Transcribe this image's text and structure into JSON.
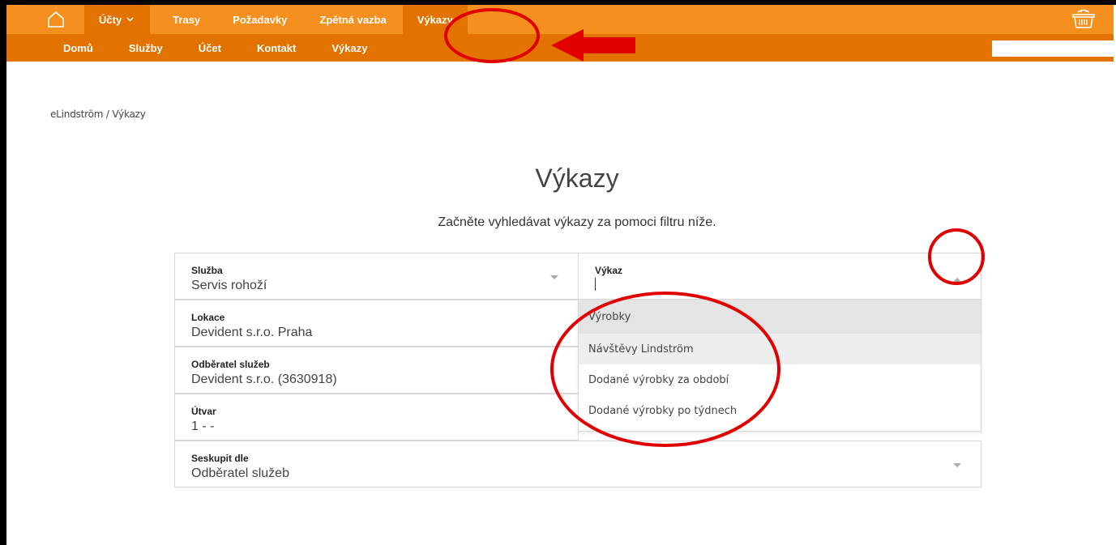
{
  "topnav": {
    "items": [
      {
        "label": "Účty",
        "has_dropdown": true
      },
      {
        "label": "Trasy"
      },
      {
        "label": "Požadavky"
      },
      {
        "label": "Zpětná vazba"
      },
      {
        "label": "Výkazy"
      }
    ]
  },
  "subnav": {
    "items": [
      "Domů",
      "Služby",
      "Účet",
      "Kontakt",
      "Výkazy"
    ],
    "search_placeholder": ""
  },
  "breadcrumb": "eLindström / Výkazy",
  "page": {
    "title": "Výkazy",
    "subtitle": "Začněte vyhledávat výkazy za pomoci filtru níže."
  },
  "form": {
    "sluzba": {
      "label": "Služba",
      "value": "Servis rohoží"
    },
    "lokace": {
      "label": "Lokace",
      "value": "Devident s.r.o. Praha"
    },
    "odberatel": {
      "label": "Odběratel služeb",
      "value": "Devident s.r.o. (3630918)"
    },
    "utvar": {
      "label": "Útvar",
      "value": "1 - -"
    },
    "seskupit": {
      "label": "Seskupit dle",
      "value": "Odběratel služeb"
    },
    "vykaz": {
      "label": "Výkaz",
      "value": ""
    }
  },
  "dropdown": {
    "options": [
      "Výrobky",
      "Návštěvy Lindström",
      "Dodané výrobky za období",
      "Dodané výrobky po týdnech"
    ]
  },
  "colors": {
    "nav_primary": "#f5901e",
    "nav_secondary": "#e27300",
    "annotation": "#e00000"
  }
}
